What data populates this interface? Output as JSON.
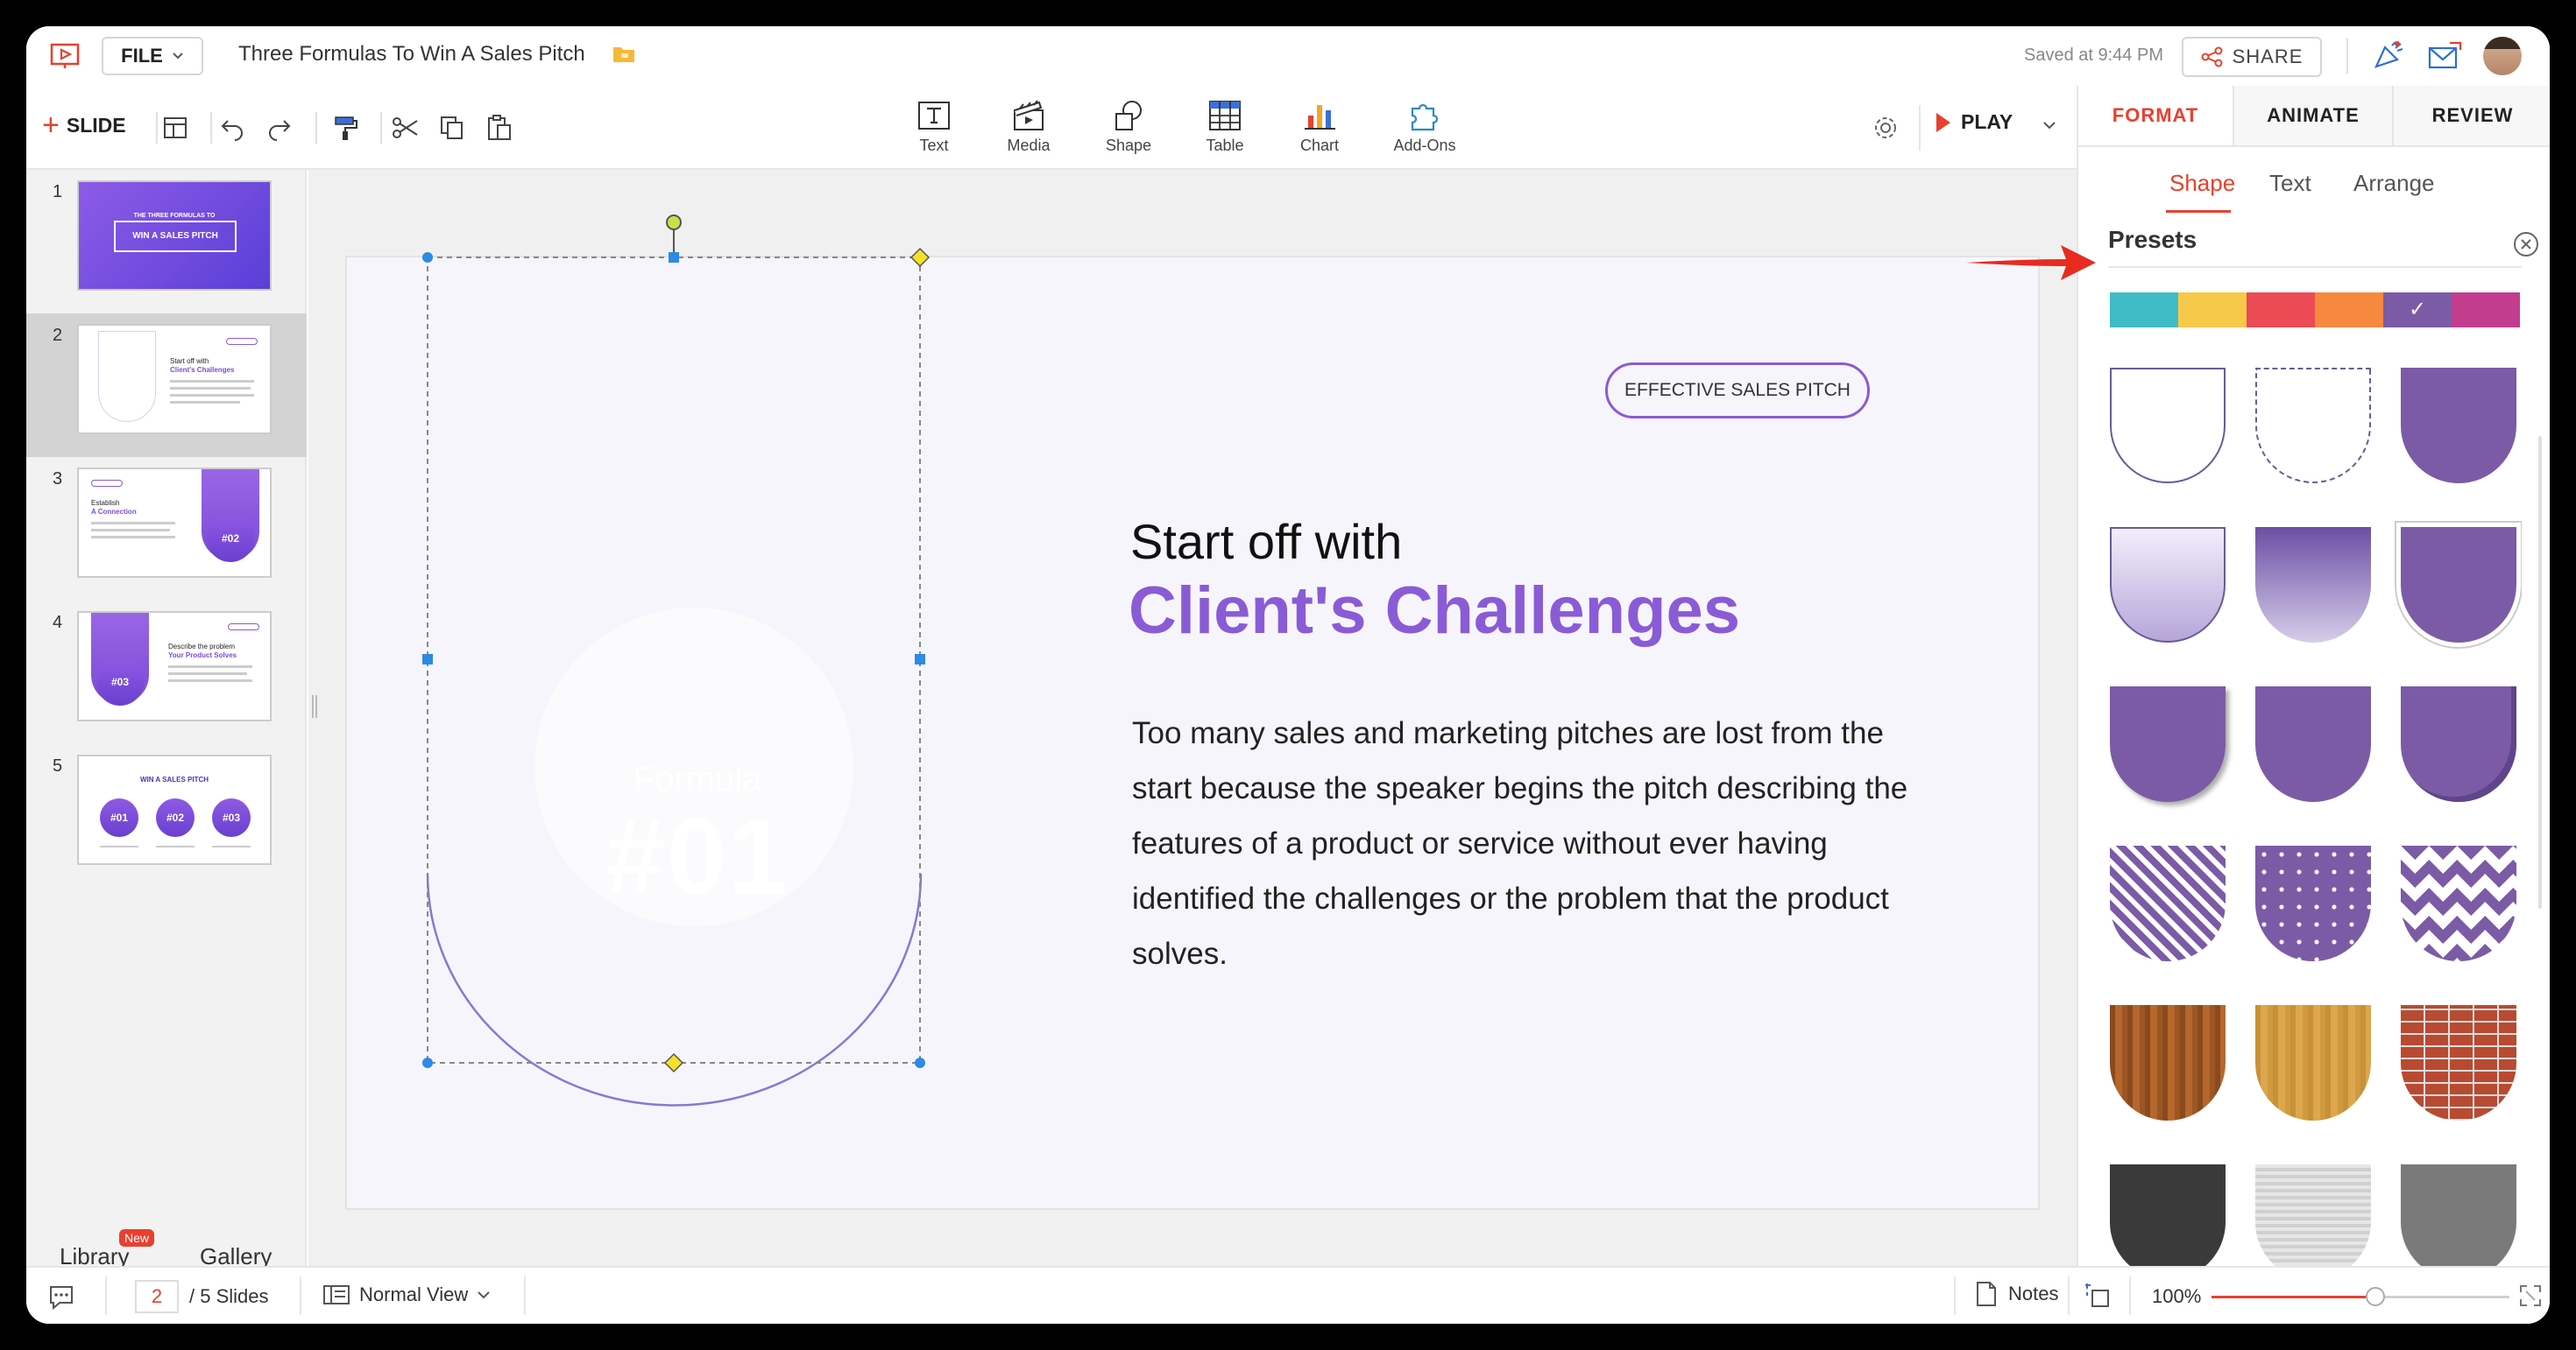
{
  "header": {
    "file_label": "FILE",
    "doc_title": "Three Formulas To Win A Sales Pitch",
    "saved_text": "Saved at 9:44 PM",
    "share_label": "SHARE"
  },
  "toolbar": {
    "slide_label": "SLIDE",
    "insert_tools": [
      {
        "label": "Text",
        "icon": "text-box-icon"
      },
      {
        "label": "Media",
        "icon": "media-clapper-icon"
      },
      {
        "label": "Shape",
        "icon": "shape-icon"
      },
      {
        "label": "Table",
        "icon": "table-icon"
      },
      {
        "label": "Chart",
        "icon": "bar-chart-icon"
      },
      {
        "label": "Add-Ons",
        "icon": "puzzle-icon"
      }
    ],
    "play_label": "PLAY"
  },
  "slides": {
    "numbers": [
      "1",
      "2",
      "3",
      "4",
      "5"
    ],
    "active": "2",
    "thumb1_title": "WIN A SALES PITCH",
    "thumb1_sub": "THE THREE FORMULAS TO",
    "thumb2_title": "Client's Challenges",
    "thumb2_pre": "Start off with",
    "thumb3_pre": "Establish",
    "thumb3_title": "A Connection",
    "thumb3_badge": "#02",
    "thumb4_pre": "Describe the problem",
    "thumb4_title": "Your Product Solves",
    "thumb4_badge": "#03",
    "thumb5_title": "WIN A SALES PITCH",
    "thumb5_badges": [
      "#01",
      "#02",
      "#03"
    ]
  },
  "sidebar_bottom": {
    "library_label": "Library",
    "library_badge": "New",
    "gallery_label": "Gallery"
  },
  "slide": {
    "pill_label": "EFFECTIVE SALES PITCH",
    "heading_line1": "Start off with",
    "heading_line2": "Client's Challenges",
    "body": "Too many sales and marketing pitches are lost from the start because the speaker begins the pitch describing the features of a product or service without ever having identified the challenges or the problem that the product solves.",
    "formula_word": "Formula",
    "formula_num": "#01"
  },
  "right_panel": {
    "tabs": [
      "FORMAT",
      "ANIMATE",
      "REVIEW"
    ],
    "active_tab": "FORMAT",
    "sub_tabs": [
      "Shape",
      "Text",
      "Arrange"
    ],
    "active_sub_tab": "Shape",
    "presets_title": "Presets",
    "palette": [
      "#3fbcc6",
      "#f7c94a",
      "#ea4b55",
      "#f6893e",
      "#7b5ba6",
      "#c23d8e"
    ],
    "selected_palette": "#7b5ba6",
    "accent": "#e8402d",
    "brand_purple": "#8a5bd6"
  },
  "statusbar": {
    "current_page": "2",
    "total_pages": "/ 5 Slides",
    "view_label": "Normal View",
    "notes_label": "Notes",
    "zoom": "100%",
    "zoom_slider_fraction": 0.55
  }
}
